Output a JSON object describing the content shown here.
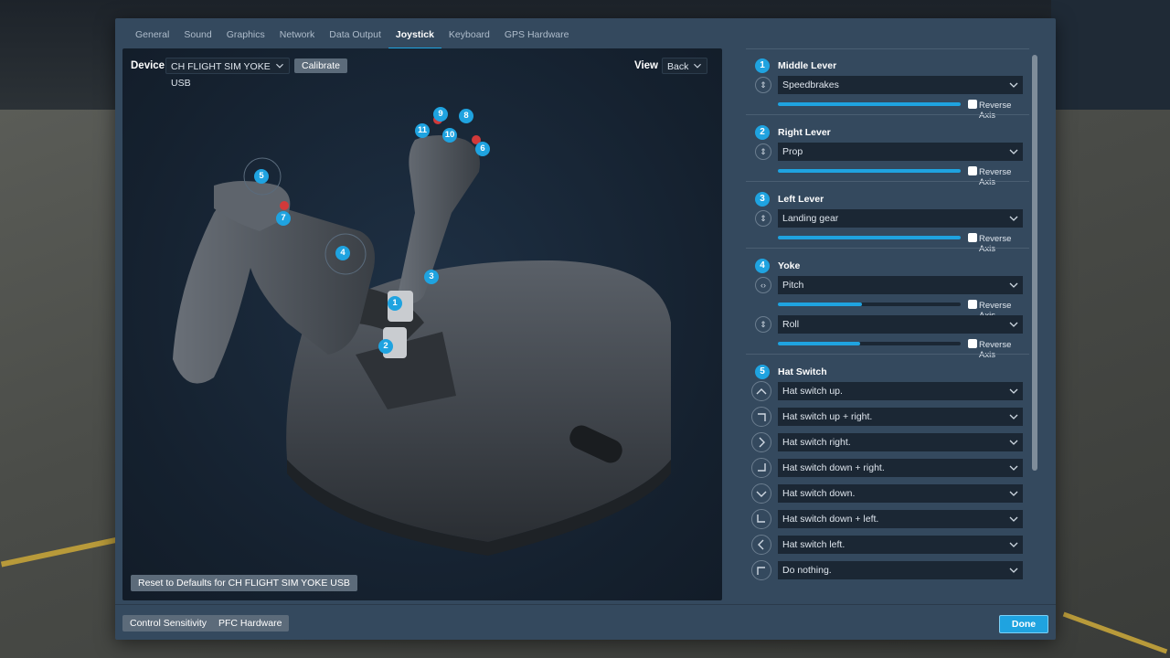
{
  "tabs": [
    "General",
    "Sound",
    "Graphics",
    "Network",
    "Data Output",
    "Joystick",
    "Keyboard",
    "GPS Hardware"
  ],
  "active_tab": "Joystick",
  "viewer": {
    "device_label": "Device",
    "device_value": "CH FLIGHT SIM YOKE USB",
    "calibrate_label": "Calibrate",
    "view_label": "View",
    "view_value": "Back",
    "reset_label": "Reset to Defaults for CH FLIGHT SIM YOKE USB",
    "markers": [
      "1",
      "2",
      "3",
      "4",
      "5",
      "6",
      "7",
      "8",
      "9",
      "10",
      "11"
    ]
  },
  "panel": {
    "reverse_label": "Reverse Axis",
    "sections": [
      {
        "num": "1",
        "title": "Middle Lever",
        "axes": [
          {
            "value": "Speedbrakes",
            "fill": 1.0
          }
        ]
      },
      {
        "num": "2",
        "title": "Right Lever",
        "axes": [
          {
            "value": "Prop",
            "fill": 1.0
          }
        ]
      },
      {
        "num": "3",
        "title": "Left Lever",
        "axes": [
          {
            "value": "Landing gear",
            "fill": 1.0
          }
        ]
      },
      {
        "num": "4",
        "title": "Yoke",
        "axes": [
          {
            "value": "Pitch",
            "fill": 0.46
          },
          {
            "value": "Roll",
            "fill": 0.45
          }
        ]
      }
    ],
    "hat": {
      "num": "5",
      "title": "Hat Switch",
      "items": [
        {
          "icon": "up",
          "value": "Hat switch up."
        },
        {
          "icon": "up-right",
          "value": "Hat switch up + right."
        },
        {
          "icon": "right",
          "value": "Hat switch right."
        },
        {
          "icon": "down-right",
          "value": "Hat switch down + right."
        },
        {
          "icon": "down",
          "value": "Hat switch down."
        },
        {
          "icon": "down-left",
          "value": "Hat switch down + left."
        },
        {
          "icon": "left",
          "value": "Hat switch left."
        },
        {
          "icon": "up-left",
          "value": "Do nothing."
        }
      ]
    }
  },
  "footer": {
    "control_sensitivity": "Control Sensitivity",
    "pfc_hardware": "PFC Hardware",
    "done": "Done"
  },
  "colors": {
    "accent": "#1fa3e0",
    "window": "#34495e",
    "viewer": "#15212f"
  }
}
